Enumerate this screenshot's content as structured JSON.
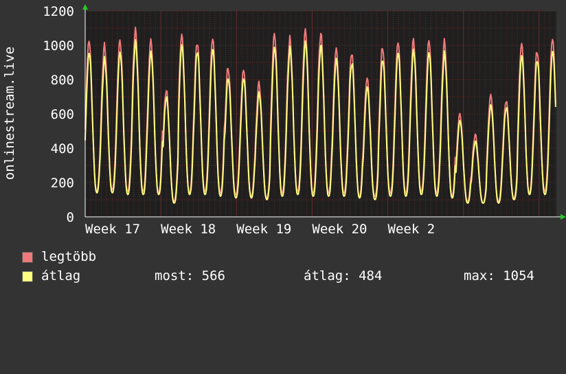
{
  "colors": {
    "background": "#333333",
    "plot_area": "#1f1f1f",
    "grid": "#6b2a2a",
    "max_series": "#f07a7a",
    "avg_series": "#ffff80",
    "axis_arrow": "#22cc22"
  },
  "legend": {
    "max_label": "legtöbb",
    "avg_label": "átlag",
    "now_text": "most: 566",
    "avg_text": "átlag: 484",
    "max_text": "max: 1054"
  },
  "chart_data": {
    "type": "line",
    "ylabel": "onlinestream.live",
    "xlabel": "",
    "ylim": [
      0,
      1200
    ],
    "yticks": [
      0,
      200,
      400,
      600,
      800,
      1000,
      1200
    ],
    "xtick_labels": [
      "Week 17",
      "Week 18",
      "Week 19",
      "Week 20",
      "Week 2"
    ],
    "x_unit": "day",
    "x_range": [
      0,
      43.6
    ],
    "xtick_positions": [
      0,
      7,
      14,
      21,
      28
    ],
    "grid": true,
    "series": [
      {
        "name": "legtöbb",
        "color": "#f07a7a",
        "daily_peaks": [
          1030,
          1000,
          1030,
          1090,
          1030,
          740,
          1060,
          1020,
          1040,
          870,
          860,
          780,
          1070,
          1040,
          1090,
          1070,
          980,
          960,
          810,
          990,
          1020,
          1030,
          1030,
          1020,
          600,
          480,
          710,
          680,
          1010,
          970,
          1040
        ],
        "daily_lows": [
          150,
          160,
          150,
          150,
          140,
          90,
          140,
          150,
          140,
          130,
          120,
          110,
          140,
          150,
          140,
          140,
          140,
          120,
          120,
          140,
          140,
          150,
          140,
          120,
          90,
          80,
          90,
          110,
          140,
          150,
          150
        ]
      },
      {
        "name": "átlag",
        "color": "#ffff80",
        "daily_peaks": [
          960,
          920,
          960,
          1020,
          960,
          700,
          1000,
          970,
          980,
          810,
          810,
          720,
          990,
          980,
          1020,
          1000,
          920,
          900,
          760,
          920,
          960,
          970,
          960,
          950,
          560,
          440,
          650,
          640,
          940,
          920,
          970
        ],
        "daily_lows": [
          140,
          140,
          130,
          130,
          130,
          80,
          130,
          130,
          120,
          110,
          110,
          100,
          120,
          130,
          120,
          120,
          120,
          110,
          100,
          120,
          120,
          130,
          120,
          110,
          80,
          80,
          80,
          100,
          130,
          130,
          130
        ]
      }
    ]
  }
}
